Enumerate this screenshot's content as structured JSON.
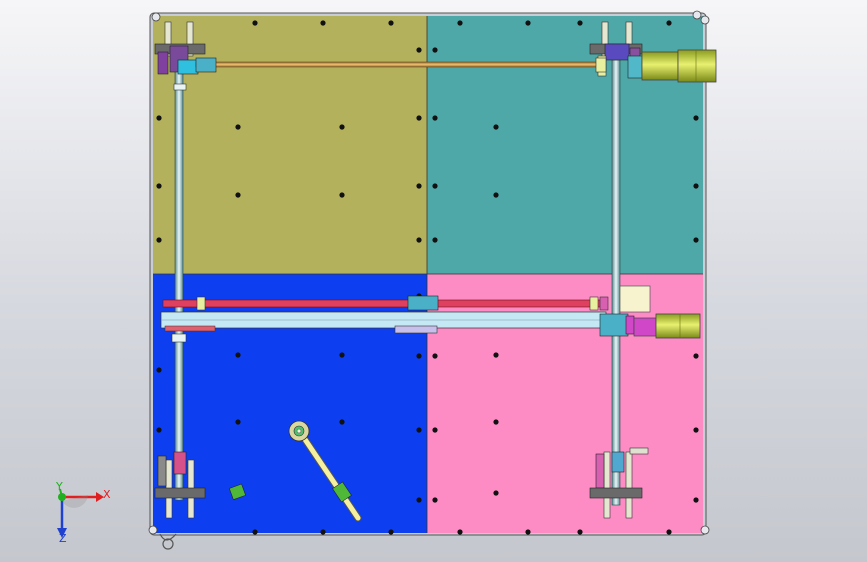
{
  "viewport": {
    "background_top": "#f6f6f8",
    "background_bottom": "#c5c7ce"
  },
  "plate": {
    "quadrant_colors": {
      "top_left": "#b3b15b",
      "top_right": "#4ea8a8",
      "bottom_left": "#0d3ff1",
      "bottom_right": "#fd8cc5"
    },
    "frame_color": "#c8ccd4"
  },
  "parts": {
    "lead_screw_color": "#d8a050",
    "red_rail_color": "#e04060",
    "motor_color": "#d8e840",
    "slider_color": "#8fd0e8",
    "link_color": "#f4f0a0",
    "cube_color": "#f7f3cf",
    "block_color": "#50b838"
  },
  "triad": {
    "x_label": "X",
    "y_label": "Y",
    "z_label": "Z",
    "x_color": "#e02020",
    "y_color": "#20b020",
    "z_color": "#2040d0"
  }
}
